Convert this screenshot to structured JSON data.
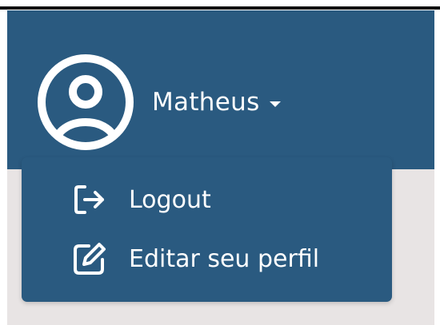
{
  "user_menu": {
    "username": "Matheus",
    "avatar_icon": "user-circle-icon",
    "caret_icon": "caret-down-icon"
  },
  "dropdown": {
    "items": [
      {
        "label": "Logout",
        "icon": "logout-icon"
      },
      {
        "label": "Editar seu perfil",
        "icon": "edit-icon"
      }
    ]
  },
  "colors": {
    "header_bg": "#2a5a80",
    "content_bg": "#e8e4e4",
    "text": "#ffffff"
  }
}
